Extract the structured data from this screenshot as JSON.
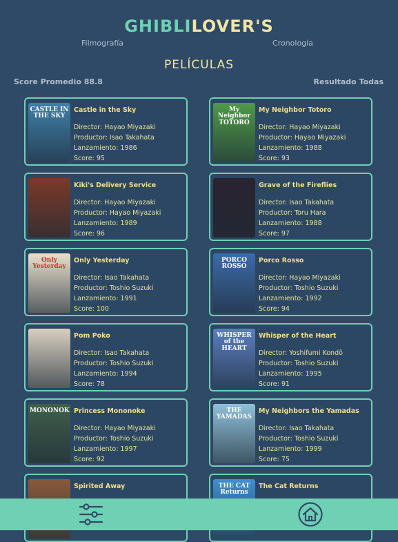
{
  "header": {
    "brand_part1": "GHIBLI",
    "brand_part2": "LOVER'S"
  },
  "nav": {
    "filmography": "Filmografía",
    "chronology": "Cronología"
  },
  "section_title": "PELÍCULAS",
  "stats": {
    "average": "Score Promedio 88.8",
    "result": "Resultado Todas"
  },
  "labels": {
    "director": "Director:",
    "producer": "Productor:",
    "release": "Lanzamiento:",
    "score": "Score:"
  },
  "films": [
    {
      "title": "Castle in the Sky",
      "director": "Hayao Miyazaki",
      "producer": "Isao Takahata",
      "release": "1986",
      "score": "95",
      "poster_text": "CASTLE IN THE SKY",
      "poster_color": "#3f7fa8"
    },
    {
      "title": "My Neighbor Totoro",
      "director": "Hayao Miyazaki",
      "producer": "Hayao Miyazaki",
      "release": "1988",
      "score": "93",
      "poster_text": "My Neighbor TOTORO",
      "poster_color": "#4f9a48"
    },
    {
      "title": "Kiki's Delivery Service",
      "director": "Hayao Miyazaki",
      "producer": "Hayao Miyazaki",
      "release": "1989",
      "score": "96",
      "poster_text": "",
      "poster_color": "#7a3a2a"
    },
    {
      "title": "Grave of the Fireflies",
      "director": "Isao Takahata",
      "producer": "Toru Hara",
      "release": "1988",
      "score": "97",
      "poster_text": "",
      "poster_color": "#2a2330"
    },
    {
      "title": "Only Yesterday",
      "director": "Isao Takahata",
      "producer": "Toshio Suzuki",
      "release": "1991",
      "score": "100",
      "poster_text": "Only Yesterday",
      "poster_color": "#e8e0cc"
    },
    {
      "title": "Porco Rosso",
      "director": "Hayao Miyazaki",
      "producer": "Toshio Suzuki",
      "release": "1992",
      "score": "94",
      "poster_text": "PORCO ROSSO",
      "poster_color": "#3d6aa8"
    },
    {
      "title": "Pom Poko",
      "director": "Isao Takahata",
      "producer": "Toshio Suzuki",
      "release": "1994",
      "score": "78",
      "poster_text": "",
      "poster_color": "#d9cfc0"
    },
    {
      "title": "Whisper of the Heart",
      "director": "Yoshifumi Kondō",
      "producer": "Toshio Suzuki",
      "release": "1995",
      "score": "91",
      "poster_text": "WHISPER of the HEART",
      "poster_color": "#5a7fc0"
    },
    {
      "title": "Princess Mononoke",
      "director": "Hayao Miyazaki",
      "producer": "Toshio Suzuki",
      "release": "1997",
      "score": "92",
      "poster_text": "MONONOKE",
      "poster_color": "#3f5f4a"
    },
    {
      "title": "My Neighbors the Yamadas",
      "director": "Isao Takahata",
      "producer": "Toshio Suzuki",
      "release": "1999",
      "score": "75",
      "poster_text": "THE YAMADAS",
      "poster_color": "#8fc0d8"
    },
    {
      "title": "Spirited Away",
      "director": "",
      "producer": "",
      "release": "",
      "score": "",
      "poster_text": "",
      "poster_color": "#8a5a3a"
    },
    {
      "title": "The Cat Returns",
      "director": "",
      "producer": "",
      "release": "",
      "score": "",
      "poster_text": "THE CAT Returns",
      "poster_color": "#3f8fd0"
    }
  ],
  "bottom_bar": {
    "filter_icon": "sliders-icon",
    "home_icon": "home-icon",
    "color": "#6fd0b4"
  }
}
